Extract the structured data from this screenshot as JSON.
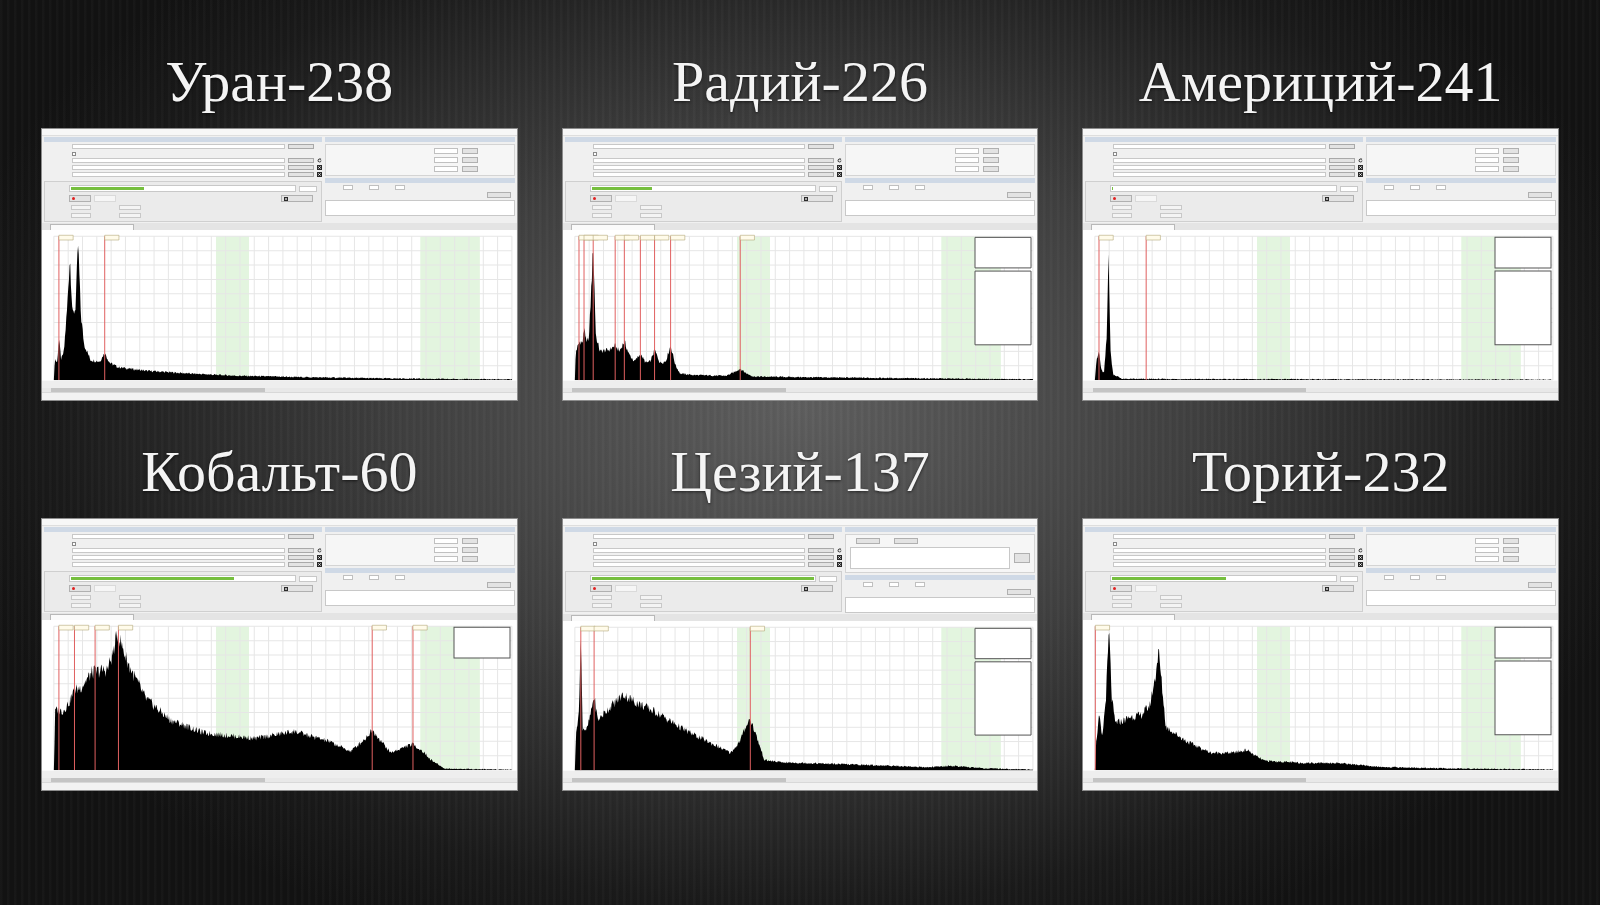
{
  "isotopes": [
    {
      "title": "Уран-238",
      "screenshot": {
        "kind": "coefficients",
        "autosave": {
          "checked": false
        },
        "progress": {
          "level": 0.33
        }
      }
    },
    {
      "title": "Радий-226",
      "screenshot": {
        "kind": "coefficients",
        "autosave": {
          "checked": false
        },
        "progress": {
          "level": 0.27
        }
      }
    },
    {
      "title": "Америций-241",
      "screenshot": {
        "kind": "coefficients",
        "autosave": {
          "checked": false
        },
        "progress": {
          "level": 0.003
        }
      }
    },
    {
      "title": "Кобальт-60",
      "screenshot": {
        "kind": "coefficients",
        "autosave": {
          "checked": false
        },
        "progress": {
          "level": 0.73
        }
      }
    },
    {
      "title": "Цезий-137",
      "screenshot": {
        "kind": "points",
        "autosave": {
          "checked": false
        },
        "progress": {
          "level": 1.0
        }
      }
    },
    {
      "title": "Торий-232",
      "screenshot": {
        "kind": "coefficients",
        "autosave": {
          "checked": false
        },
        "progress": {
          "level": 0.51
        }
      }
    }
  ]
}
